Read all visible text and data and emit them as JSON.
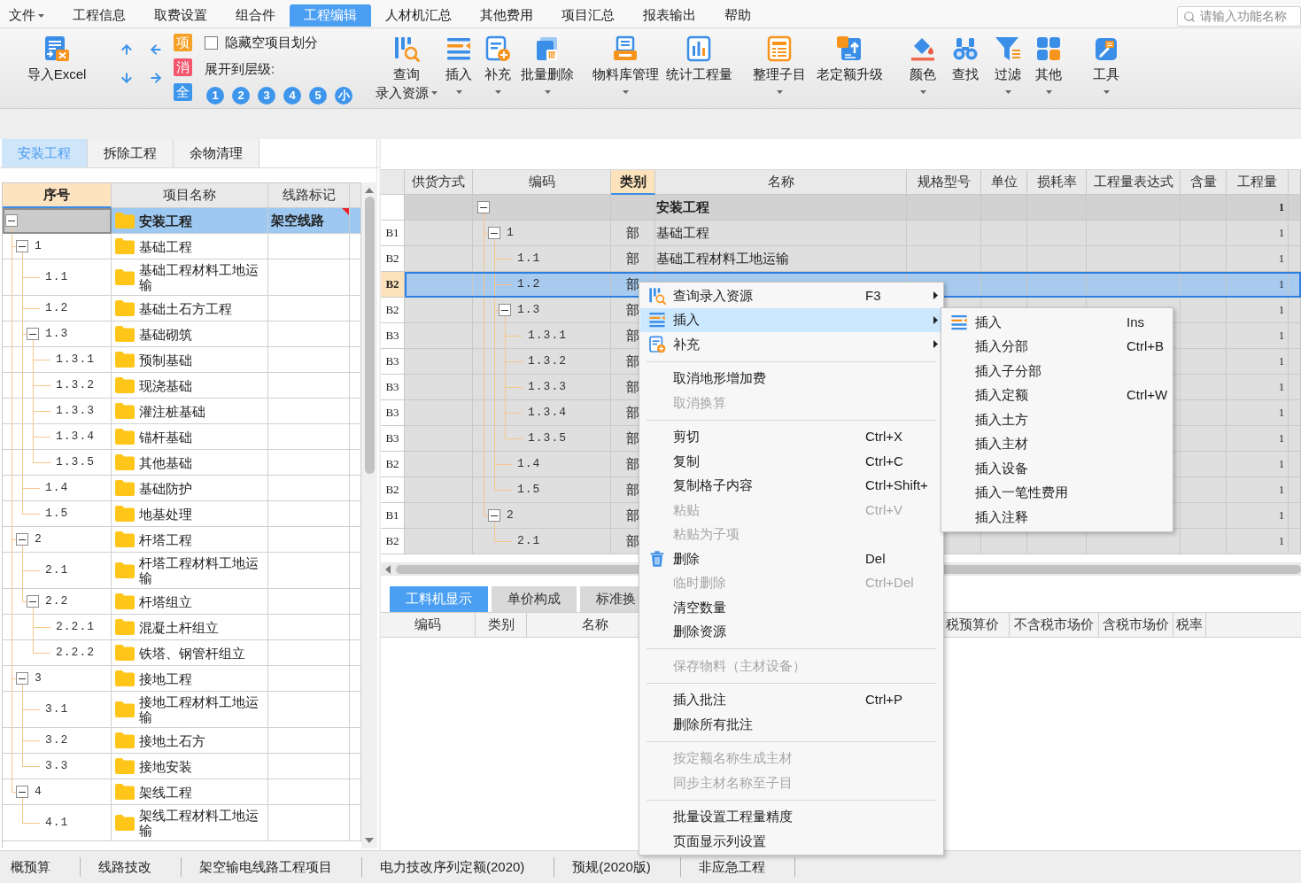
{
  "menu_bar": {
    "tabs": [
      {
        "label": "文件",
        "dropdown": true,
        "selected": false
      },
      {
        "label": "工程信息",
        "dropdown": false,
        "selected": false
      },
      {
        "label": "取费设置",
        "dropdown": false,
        "selected": false
      },
      {
        "label": "组合件",
        "dropdown": false,
        "selected": false
      },
      {
        "label": "工程编辑",
        "dropdown": false,
        "selected": true
      },
      {
        "label": "人材机汇总",
        "dropdown": false,
        "selected": false
      },
      {
        "label": "其他费用",
        "dropdown": false,
        "selected": false
      },
      {
        "label": "项目汇总",
        "dropdown": false,
        "selected": false
      },
      {
        "label": "报表输出",
        "dropdown": false,
        "selected": false
      },
      {
        "label": "帮助",
        "dropdown": false,
        "selected": false
      }
    ],
    "search": {
      "placeholder": "请输入功能名称"
    }
  },
  "toolbar": {
    "import_button": {
      "label": "导入Excel"
    },
    "badges": [
      {
        "label": "项",
        "color": "#f7a027"
      },
      {
        "label": "消",
        "color": "#f2576c"
      },
      {
        "label": "全",
        "color": "#3d95ec"
      }
    ],
    "hide_empty": {
      "label": "隐藏空项目划分",
      "checked": false
    },
    "expand_levels": {
      "label": "展开到层级:",
      "levels": [
        "1",
        "2",
        "3",
        "4",
        "5",
        "小"
      ]
    },
    "buttons": [
      {
        "label": "查询",
        "sublabel": "录入资源",
        "dropdown": true
      },
      {
        "label": "插入",
        "dropdown": true
      },
      {
        "label": "补充",
        "dropdown": true
      },
      {
        "label": "批量删除",
        "dropdown": true
      },
      {
        "label": "物料库管理",
        "dropdown": true
      },
      {
        "label": "统计工程量",
        "dropdown": false
      },
      {
        "label": "整理子目",
        "dropdown": true
      },
      {
        "label": "老定额升级",
        "dropdown": false
      },
      {
        "label": "颜色",
        "dropdown": true
      },
      {
        "label": "查找",
        "dropdown": false
      },
      {
        "label": "过滤",
        "dropdown": true
      },
      {
        "label": "其他",
        "dropdown": true
      },
      {
        "label": "工具",
        "dropdown": true
      }
    ]
  },
  "left_panel": {
    "tabs": [
      {
        "label": "安装工程",
        "selected": true
      },
      {
        "label": "拆除工程",
        "selected": false
      },
      {
        "label": "余物清理",
        "selected": false
      }
    ],
    "tree": {
      "columns": [
        {
          "label": "序号",
          "selected": true
        },
        {
          "label": "项目名称",
          "selected": false
        },
        {
          "label": "线路标记",
          "selected": false
        }
      ],
      "rows": [
        {
          "name": "安装工程",
          "mark": "架空线路",
          "noted": true,
          "selected": true,
          "expanded": true,
          "children": [
            {
              "seq": "1",
              "name": "基础工程",
              "noted": false,
              "selected": false,
              "expanded": true,
              "children": [
                {
                  "seq": "1.1",
                  "name": "基础工程材料工地运输",
                  "noted": false,
                  "selected": false
                },
                {
                  "seq": "1.2",
                  "name": "基础土石方工程",
                  "noted": false,
                  "selected": false
                },
                {
                  "seq": "1.3",
                  "name": "基础砌筑",
                  "noted": false,
                  "selected": false,
                  "expanded": true,
                  "children": [
                    {
                      "seq": "1.3.1",
                      "name": "预制基础",
                      "noted": false,
                      "selected": false
                    },
                    {
                      "seq": "1.3.2",
                      "name": "现浇基础",
                      "noted": false,
                      "selected": false
                    },
                    {
                      "seq": "1.3.3",
                      "name": "灌注桩基础",
                      "noted": false,
                      "selected": false
                    },
                    {
                      "seq": "1.3.4",
                      "name": "锚杆基础",
                      "noted": false,
                      "selected": false
                    },
                    {
                      "seq": "1.3.5",
                      "name": "其他基础",
                      "noted": false,
                      "selected": false
                    }
                  ]
                },
                {
                  "seq": "1.4",
                  "name": "基础防护",
                  "noted": false,
                  "selected": false
                },
                {
                  "seq": "1.5",
                  "name": "地基处理",
                  "noted": false,
                  "selected": false
                }
              ]
            },
            {
              "seq": "2",
              "name": "杆塔工程",
              "noted": false,
              "selected": false,
              "expanded": true,
              "children": [
                {
                  "seq": "2.1",
                  "name": "杆塔工程材料工地运输",
                  "noted": false,
                  "selected": false
                },
                {
                  "seq": "2.2",
                  "name": "杆塔组立",
                  "noted": false,
                  "selected": false,
                  "expanded": true,
                  "children": [
                    {
                      "seq": "2.2.1",
                      "name": "混凝土杆组立",
                      "noted": false,
                      "selected": false
                    },
                    {
                      "seq": "2.2.2",
                      "name": "铁塔、钢管杆组立",
                      "noted": false,
                      "selected": false
                    }
                  ]
                }
              ]
            },
            {
              "seq": "3",
              "name": "接地工程",
              "noted": false,
              "selected": false,
              "expanded": true,
              "children": [
                {
                  "seq": "3.1",
                  "name": "接地工程材料工地运输",
                  "noted": false,
                  "selected": false
                },
                {
                  "seq": "3.2",
                  "name": "接地土石方",
                  "noted": false,
                  "selected": false
                },
                {
                  "seq": "3.3",
                  "name": "接地安装",
                  "noted": false,
                  "selected": false
                }
              ]
            },
            {
              "seq": "4",
              "name": "架线工程",
              "noted": false,
              "selected": false,
              "expanded": true,
              "children": [
                {
                  "seq": "4.1",
                  "name": "架线工程材料工地运输",
                  "noted": false,
                  "selected": false
                }
              ]
            }
          ]
        }
      ]
    }
  },
  "main_table": {
    "columns": [
      {
        "label": "供货方式",
        "selected": false
      },
      {
        "label": "编码",
        "selected": false
      },
      {
        "label": "类别",
        "selected": true
      },
      {
        "label": "名称",
        "selected": false
      },
      {
        "label": "规格型号",
        "selected": false
      },
      {
        "label": "单位",
        "selected": false
      },
      {
        "label": "损耗率",
        "selected": false
      },
      {
        "label": "工程量表达式",
        "selected": false
      },
      {
        "label": "含量",
        "selected": false
      },
      {
        "label": "工程量",
        "selected": false
      }
    ],
    "rows": [
      {
        "name": "安装工程",
        "quantity": "1",
        "selected": false,
        "expanded": true,
        "children": [
          {
            "level": "B1",
            "code": "1",
            "category": "部",
            "name": "基础工程",
            "quantity": "1",
            "selected": false,
            "expanded": true,
            "children": [
              {
                "level": "B2",
                "code": "1.1",
                "category": "部",
                "name": "基础工程材料工地运输",
                "quantity": "1",
                "selected": false
              },
              {
                "level": "B2",
                "code": "1.2",
                "category": "部",
                "quantity": "1",
                "selected": true
              },
              {
                "level": "B2",
                "code": "1.3",
                "category": "部",
                "quantity": "1",
                "selected": false,
                "expanded": true,
                "children": [
                  {
                    "level": "B3",
                    "code": "1.3.1",
                    "category": "部",
                    "quantity": "1",
                    "selected": false
                  },
                  {
                    "level": "B3",
                    "code": "1.3.2",
                    "category": "部",
                    "quantity": "1",
                    "selected": false
                  },
                  {
                    "level": "B3",
                    "code": "1.3.3",
                    "category": "部",
                    "quantity": "1",
                    "selected": false
                  },
                  {
                    "level": "B3",
                    "code": "1.3.4",
                    "category": "部",
                    "quantity": "1",
                    "selected": false
                  },
                  {
                    "level": "B3",
                    "code": "1.3.5",
                    "category": "部",
                    "quantity": "1",
                    "selected": false
                  }
                ]
              },
              {
                "level": "B2",
                "code": "1.4",
                "category": "部",
                "quantity": "1",
                "selected": false
              },
              {
                "level": "B2",
                "code": "1.5",
                "category": "部",
                "quantity": "1",
                "selected": false
              }
            ]
          },
          {
            "level": "B1",
            "code": "2",
            "category": "部",
            "quantity": "1",
            "selected": false,
            "expanded": true,
            "children": [
              {
                "level": "B2",
                "code": "2.1",
                "category": "部",
                "quantity": "1",
                "selected": false
              }
            ]
          }
        ]
      }
    ]
  },
  "bottom_panel": {
    "tabs": [
      {
        "label": "工料机显示",
        "selected": true
      },
      {
        "label": "单价构成",
        "selected": false
      },
      {
        "label": "标准换",
        "selected": false
      }
    ],
    "columns": [
      "编码",
      "类别",
      "名称",
      "税预算价",
      "不含税市场价",
      "含税市场价",
      "税率"
    ]
  },
  "context_menu": {
    "items": [
      {
        "kind": "item",
        "label": "查询录入资源",
        "shortcut": "F3",
        "submenu": true,
        "disabled": false,
        "selected": false
      },
      {
        "kind": "item",
        "label": "插入",
        "submenu": true,
        "disabled": false,
        "selected": true
      },
      {
        "kind": "item",
        "label": "补充",
        "submenu": true,
        "disabled": false,
        "selected": false
      },
      {
        "kind": "separator"
      },
      {
        "kind": "item",
        "label": "取消地形增加费",
        "submenu": false,
        "disabled": false,
        "selected": false
      },
      {
        "kind": "item",
        "label": "取消换算",
        "submenu": false,
        "disabled": true,
        "selected": false
      },
      {
        "kind": "separator"
      },
      {
        "kind": "item",
        "label": "剪切",
        "shortcut": "Ctrl+X",
        "submenu": false,
        "disabled": false,
        "selected": false
      },
      {
        "kind": "item",
        "label": "复制",
        "shortcut": "Ctrl+C",
        "submenu": false,
        "disabled": false,
        "selected": false
      },
      {
        "kind": "item",
        "label": "复制格子内容",
        "shortcut": "Ctrl+Shift+",
        "submenu": false,
        "disabled": false,
        "selected": false
      },
      {
        "kind": "item",
        "label": "粘贴",
        "shortcut": "Ctrl+V",
        "submenu": false,
        "disabled": true,
        "selected": false
      },
      {
        "kind": "item",
        "label": "粘贴为子项",
        "submenu": false,
        "disabled": true,
        "selected": false
      },
      {
        "kind": "item",
        "label": "删除",
        "shortcut": "Del",
        "submenu": false,
        "disabled": false,
        "selected": false
      },
      {
        "kind": "item",
        "label": "临时删除",
        "shortcut": "Ctrl+Del",
        "submenu": false,
        "disabled": true,
        "selected": false
      },
      {
        "kind": "item",
        "label": "清空数量",
        "submenu": false,
        "disabled": false,
        "selected": false
      },
      {
        "kind": "item",
        "label": "删除资源",
        "submenu": false,
        "disabled": false,
        "selected": false
      },
      {
        "kind": "separator"
      },
      {
        "kind": "item",
        "label": "保存物料（主材设备）",
        "submenu": false,
        "disabled": true,
        "selected": false
      },
      {
        "kind": "separator"
      },
      {
        "kind": "item",
        "label": "插入批注",
        "shortcut": "Ctrl+P",
        "submenu": false,
        "disabled": false,
        "selected": false
      },
      {
        "kind": "item",
        "label": "删除所有批注",
        "submenu": false,
        "disabled": false,
        "selected": false
      },
      {
        "kind": "separator"
      },
      {
        "kind": "item",
        "label": "按定额名称生成主材",
        "submenu": false,
        "disabled": true,
        "selected": false
      },
      {
        "kind": "item",
        "label": "同步主材名称至子目",
        "submenu": false,
        "disabled": true,
        "selected": false
      },
      {
        "kind": "separator"
      },
      {
        "kind": "item",
        "label": "批量设置工程量精度",
        "submenu": false,
        "disabled": false,
        "selected": false
      },
      {
        "kind": "item",
        "label": "页面显示列设置",
        "submenu": false,
        "disabled": false,
        "selected": false
      }
    ]
  },
  "submenu": {
    "items": [
      {
        "label": "插入",
        "shortcut": "Ins",
        "selected": false
      },
      {
        "label": "插入分部",
        "shortcut": "Ctrl+B",
        "selected": false
      },
      {
        "label": "插入子分部",
        "selected": false
      },
      {
        "label": "插入定额",
        "shortcut": "Ctrl+W",
        "selected": false
      },
      {
        "label": "插入土方",
        "selected": false
      },
      {
        "label": "插入主材",
        "selected": false
      },
      {
        "label": "插入设备",
        "selected": false
      },
      {
        "label": "插入一笔性费用",
        "selected": false
      },
      {
        "label": "插入注释",
        "selected": false
      }
    ]
  },
  "status_bar": {
    "items": [
      "概预算",
      "线路技改",
      "架空输电线路工程项目",
      "电力技改序列定额(2020)",
      "预规(2020版)",
      "非应急工程"
    ]
  }
}
